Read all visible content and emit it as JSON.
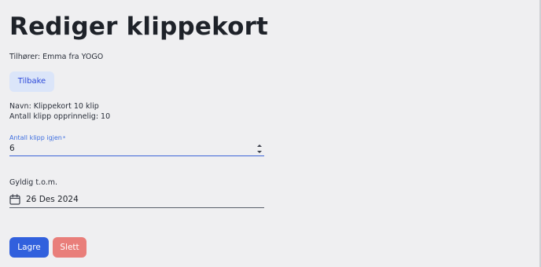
{
  "page": {
    "title": "Rediger klippekort",
    "owner": "Tilhører: Emma fra YOGO"
  },
  "actions": {
    "back_label": "Tilbake",
    "save_label": "Lagre",
    "delete_label": "Slett"
  },
  "card": {
    "name": "Navn: Klippekort 10 klip",
    "original_count": "Antall klipp opprinnelig: 10"
  },
  "fields": {
    "remaining": {
      "label": "Antall klipp igjen",
      "required_marker": "*",
      "value": "6"
    },
    "valid_until": {
      "label": "Gyldig t.o.m.",
      "value": "26 Des 2024"
    }
  },
  "icons": {
    "calendar": "calendar-icon",
    "spinner_up": "chevron-up-icon",
    "spinner_down": "chevron-down-icon"
  },
  "colors": {
    "background": "#efeff1",
    "primary": "#3160dd",
    "danger": "#e97e7a",
    "back_button_bg": "#dbe5f9",
    "focus_label": "#3f6fe0"
  }
}
